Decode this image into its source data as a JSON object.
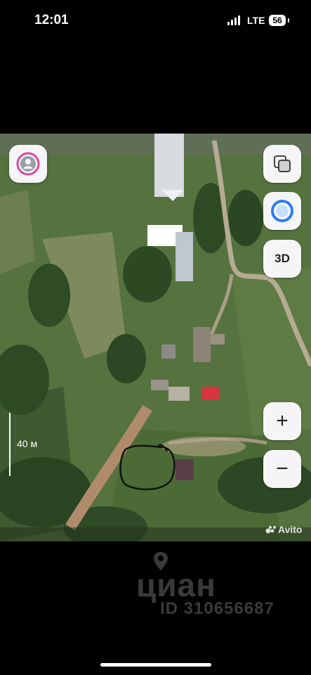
{
  "status_bar": {
    "time": "12:01",
    "network": "LTE",
    "battery": "56"
  },
  "map": {
    "scale_label": "40 м",
    "buttons": {
      "layers_icon": "layers-icon",
      "alice_icon": "assistant-icon",
      "three_d_label": "3D",
      "zoom_in_label": "+",
      "zoom_out_label": "−"
    },
    "attribution": "Avito"
  },
  "watermark": {
    "logo_text": "циан",
    "id_text": "ID 310656687"
  },
  "colors": {
    "button_bg": "#f5f5f7",
    "accent_blue": "#2d7cf6",
    "profile_ring_pink": "#d94aa0",
    "roof_red": "#d8343e"
  }
}
